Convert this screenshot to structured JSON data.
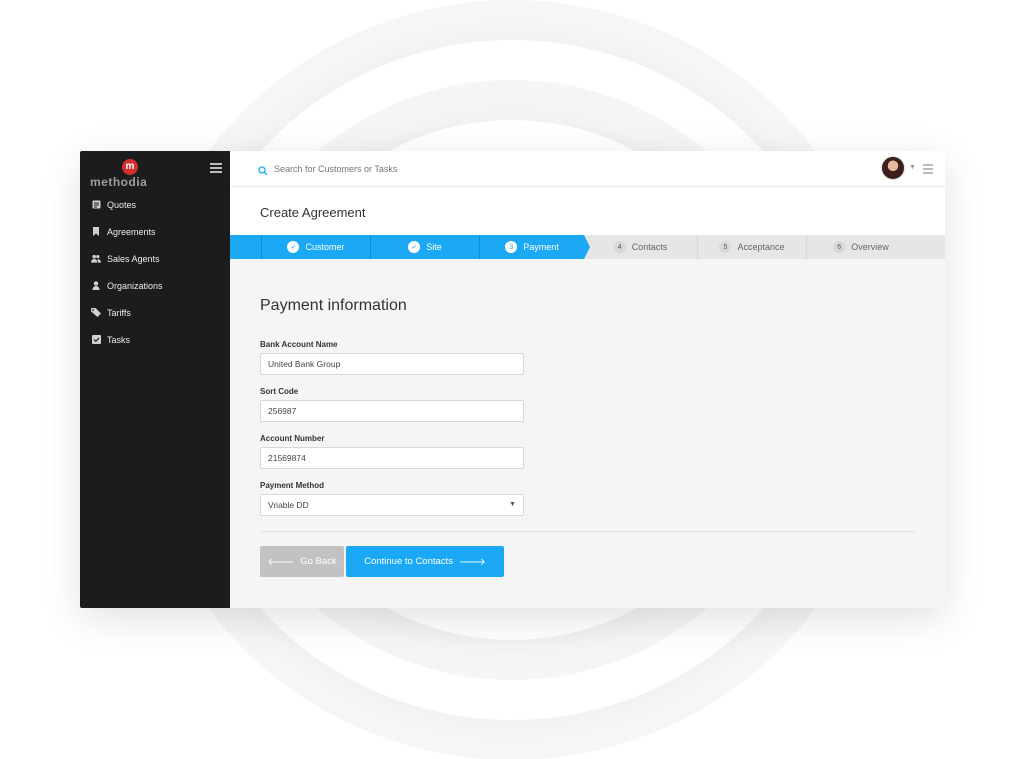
{
  "brand": {
    "logo_letter": "m",
    "name": "methodia"
  },
  "sidebar": {
    "items": [
      {
        "label": "Quotes",
        "icon": "quotes-icon"
      },
      {
        "label": "Agreements",
        "icon": "bookmark-icon"
      },
      {
        "label": "Sales Agents",
        "icon": "users-icon"
      },
      {
        "label": "Organizations",
        "icon": "organization-icon"
      },
      {
        "label": "Tariffs",
        "icon": "tag-icon"
      },
      {
        "label": "Tasks",
        "icon": "checkbox-icon"
      }
    ]
  },
  "topbar": {
    "search_placeholder": "Search for Customers or Tasks"
  },
  "page": {
    "title": "Create Agreement"
  },
  "steps": [
    {
      "number": "1",
      "label": "Customer",
      "state": "done"
    },
    {
      "number": "2",
      "label": "Site",
      "state": "done"
    },
    {
      "number": "3",
      "label": "Payment",
      "state": "active"
    },
    {
      "number": "4",
      "label": "Contacts",
      "state": "todo"
    },
    {
      "number": "5",
      "label": "Acceptance",
      "state": "todo"
    },
    {
      "number": "6",
      "label": "Overview",
      "state": "todo"
    }
  ],
  "form": {
    "title": "Payment information",
    "bank_account_name": {
      "label": "Bank Account Name",
      "value": "United Bank Group"
    },
    "sort_code": {
      "label": "Sort Code",
      "value": "256987"
    },
    "account_number": {
      "label": "Account Number",
      "value": "21569874"
    },
    "payment_method": {
      "label": "Payment Method",
      "value": "Vriable DD"
    }
  },
  "actions": {
    "back_label": "Go Back",
    "next_label": "Continue to Contacts"
  },
  "colors": {
    "accent": "#1ba9f5",
    "sidebar_bg": "#1c1c1c",
    "logo_red": "#d32f2f",
    "back_button": "#c2c2c2"
  }
}
